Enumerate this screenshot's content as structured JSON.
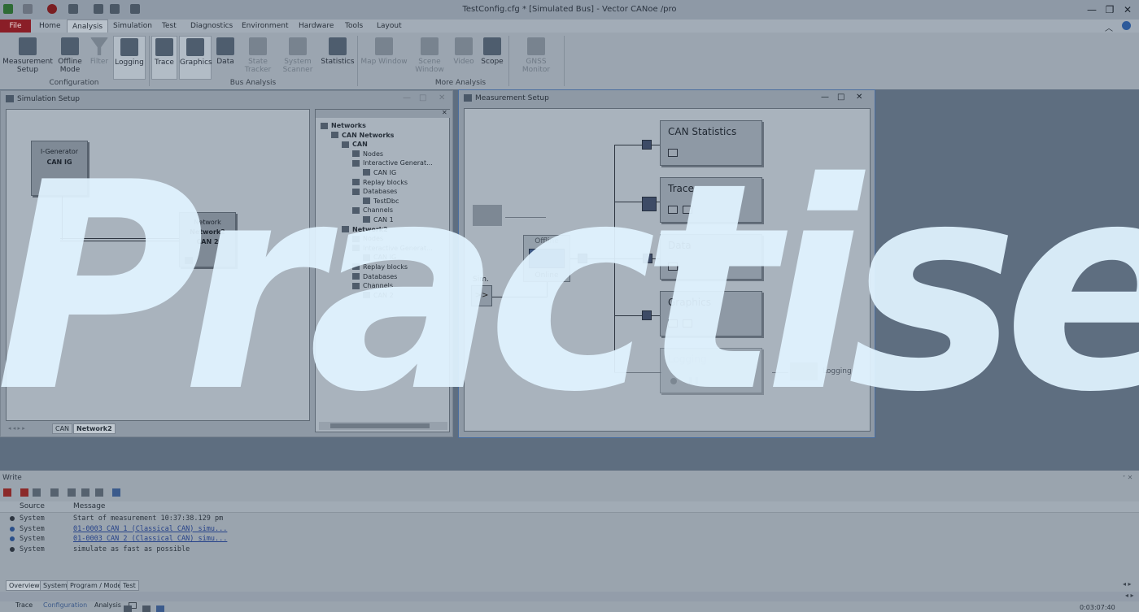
{
  "window": {
    "title": "TestConfig.cfg * [Simulated Bus] - Vector CANoe /pro"
  },
  "menu": [
    "File",
    "Home",
    "Analysis",
    "Simulation",
    "Test",
    "Diagnostics",
    "Environment",
    "Hardware",
    "Tools",
    "Layout"
  ],
  "ribbon": {
    "buttons": {
      "measurement_setup": "Measurement Setup",
      "offline_mode": "Offline Mode",
      "filter": "Filter",
      "logging": "Logging",
      "trace": "Trace",
      "graphics": "Graphics",
      "data": "Data",
      "state_tracker": "State Tracker",
      "system_scanner": "System Scanner",
      "statistics": "Statistics",
      "map_window": "Map Window",
      "scene_window": "Scene Window",
      "video": "Video",
      "scope": "Scope",
      "gnss_monitor": "GNSS Monitor"
    },
    "groups": {
      "configuration": "Configuration",
      "bus_analysis": "Bus Analysis",
      "more_analysis": "More Analysis"
    }
  },
  "sim_setup": {
    "title": "Simulation Setup",
    "generator": {
      "line1": "I-Generator",
      "line2": "CAN IG"
    },
    "network": {
      "line1": "Network",
      "line2": "Network2",
      "line3": "CAN 2"
    },
    "tabs": [
      "CAN",
      "Network2"
    ],
    "tree": [
      {
        "label": "Networks",
        "level": 0,
        "bold": true
      },
      {
        "label": "CAN Networks",
        "level": 1,
        "bold": true
      },
      {
        "label": "CAN",
        "level": 2,
        "bold": true
      },
      {
        "label": "Nodes",
        "level": 3
      },
      {
        "label": "Interactive Generat...",
        "level": 3
      },
      {
        "label": "CAN IG",
        "level": 4
      },
      {
        "label": "Replay blocks",
        "level": 3
      },
      {
        "label": "Databases",
        "level": 3
      },
      {
        "label": "TestDbc",
        "level": 4
      },
      {
        "label": "Channels",
        "level": 3
      },
      {
        "label": "CAN 1",
        "level": 4
      },
      {
        "label": "Network2",
        "level": 2,
        "bold": true
      },
      {
        "label": "Nodes",
        "level": 3
      },
      {
        "label": "Interactive Generat...",
        "level": 3
      },
      {
        "label": "CAN IG",
        "level": 4
      },
      {
        "label": "Replay blocks",
        "level": 3
      },
      {
        "label": "Databases",
        "level": 3
      },
      {
        "label": "Channels",
        "level": 3
      },
      {
        "label": "CAN 2",
        "level": 4
      }
    ]
  },
  "meas_setup": {
    "title": "Measurement Setup",
    "offline": "Offline",
    "online": "Online",
    "sim": "Sim.",
    "blocks": {
      "can_statistics": "CAN Statistics",
      "trace": "Trace",
      "data": "Data",
      "graphics": "Graphics",
      "logging": "Logging"
    },
    "logging_out": "Logging"
  },
  "write": {
    "title": "Write",
    "columns": {
      "source": "Source",
      "message": "Message"
    },
    "rows": [
      {
        "source": "System",
        "message": "Start of measurement 10:37:38.129 pm",
        "link": false
      },
      {
        "source": "System",
        "message": "01-0003 CAN 1 (Classical CAN)  simu...",
        "link": true
      },
      {
        "source": "System",
        "message": "01-0003 CAN 2 (Classical CAN)  simu...",
        "link": true
      },
      {
        "source": "System",
        "message": "  simulate as fast as possible",
        "link": false
      }
    ],
    "tabs": [
      "Overview",
      "System",
      "Program / Model",
      "Test"
    ],
    "bottom_tabs": [
      "Trace",
      "Configuration",
      "Analysis"
    ]
  },
  "status": {
    "time": "0:03:07:40"
  },
  "watermark": "Practise"
}
